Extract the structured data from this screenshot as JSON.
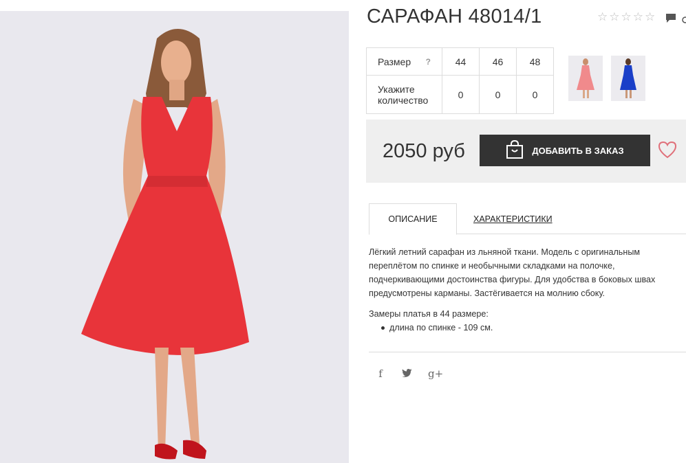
{
  "product": {
    "title": "САРАФАН 48014/1",
    "rating_stars": [
      "☆",
      "☆",
      "☆",
      "☆",
      "☆"
    ]
  },
  "sizes": {
    "header_label": "Размер",
    "help": "?",
    "values": [
      "44",
      "46",
      "48"
    ],
    "qty_label": "Укажите количество",
    "quantities": [
      "0",
      "0",
      "0"
    ]
  },
  "purchase": {
    "price": "2050 руб",
    "order_button": "ДОБАВИТЬ В ЗАКАЗ"
  },
  "tabs": {
    "description": "ОПИСАНИЕ",
    "characteristics": "ХАРАКТЕРИСТИКИ"
  },
  "description": {
    "text": "Лёгкий летний сарафан из льняной ткани. Модель с оригинальным переплётом по спинке и необычными складками на полочке, подчеркивающими достоинства фигуры. Для удобства в боковых швах предусмотрены карманы. Застёгивается на молнию сбоку.",
    "measures_title": "Замеры платья в 44 размере:",
    "measures": [
      "длина по спинке - 109 см."
    ]
  },
  "social": {
    "facebook": "f",
    "twitter": "t",
    "google": "g+"
  },
  "colors": {
    "dress_red": "#e8343a",
    "dress_pink": "#f08a8c",
    "dress_blue": "#1a3fc8",
    "button_dark": "#333333",
    "price_bg": "#efefef"
  }
}
